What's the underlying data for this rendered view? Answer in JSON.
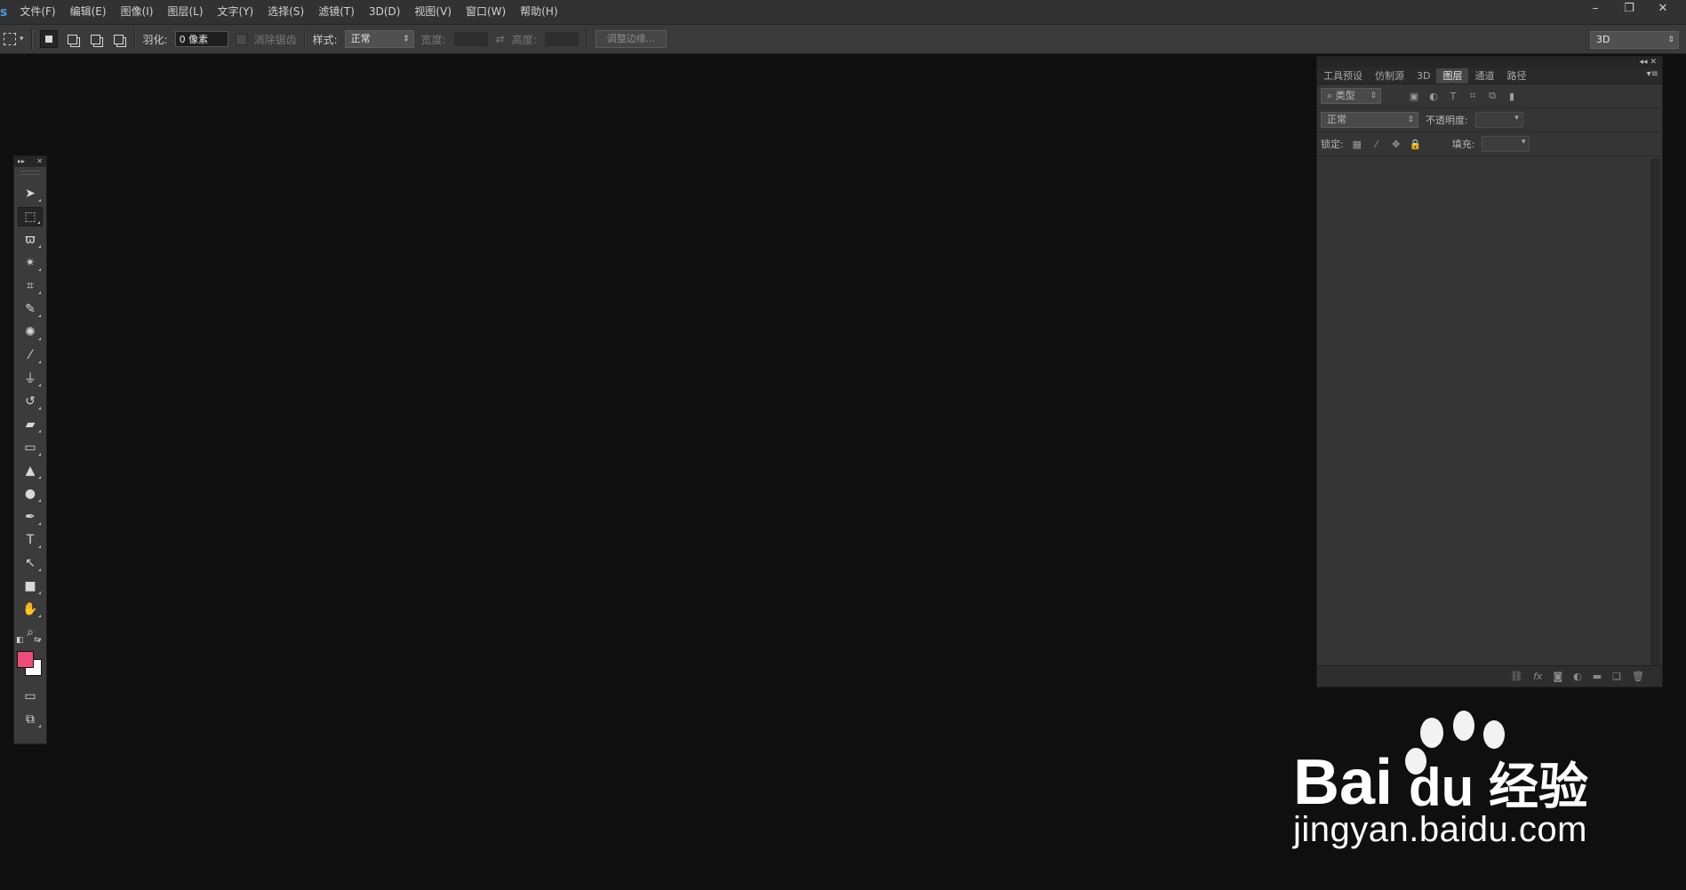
{
  "menubar": {
    "logo": "s",
    "items": [
      "文件(F)",
      "编辑(E)",
      "图像(I)",
      "图层(L)",
      "文字(Y)",
      "选择(S)",
      "滤镜(T)",
      "3D(D)",
      "视图(V)",
      "窗口(W)",
      "帮助(H)"
    ],
    "window_controls": [
      "–",
      "❐",
      "✕"
    ]
  },
  "options": {
    "feather_label": "羽化:",
    "feather_value": "0 像素",
    "antialias_label": "消除锯齿",
    "style_label": "样式:",
    "style_value": "正常",
    "width_label": "宽度:",
    "height_label": "高度:",
    "refine_label": "调整边缘...",
    "workspace_value": "3D"
  },
  "tools": {
    "items": [
      {
        "name": "move-tool",
        "glyph": "➤"
      },
      {
        "name": "rect-marquee-tool",
        "glyph": "⬚"
      },
      {
        "name": "lasso-tool",
        "glyph": "ϖ"
      },
      {
        "name": "magic-wand-tool",
        "glyph": "✴"
      },
      {
        "name": "crop-tool",
        "glyph": "⌗"
      },
      {
        "name": "eyedropper-tool",
        "glyph": "✎"
      },
      {
        "name": "healing-brush-tool",
        "glyph": "✺"
      },
      {
        "name": "brush-tool",
        "glyph": "⁄"
      },
      {
        "name": "clone-stamp-tool",
        "glyph": "⏚"
      },
      {
        "name": "history-brush-tool",
        "glyph": "↺"
      },
      {
        "name": "eraser-tool",
        "glyph": "▰"
      },
      {
        "name": "gradient-tool",
        "glyph": "▭"
      },
      {
        "name": "blur-tool",
        "glyph": "▲"
      },
      {
        "name": "dodge-tool",
        "glyph": "●"
      },
      {
        "name": "pen-tool",
        "glyph": "✒"
      },
      {
        "name": "type-tool",
        "glyph": "T"
      },
      {
        "name": "path-selection-tool",
        "glyph": "↖"
      },
      {
        "name": "rectangle-shape-tool",
        "glyph": "■"
      },
      {
        "name": "hand-tool",
        "glyph": "✋"
      },
      {
        "name": "zoom-tool",
        "glyph": "⌕"
      }
    ],
    "foreground_color": "#ee4a7a",
    "background_color": "#ffffff"
  },
  "layers_panel": {
    "tabs": [
      "工具预设",
      "仿制源",
      "3D",
      "图层",
      "通道",
      "路径"
    ],
    "active_tab": "图层",
    "filter_kind": "类型",
    "blend_mode": "正常",
    "opacity_label": "不透明度:",
    "lock_label": "锁定:",
    "fill_label": "填充:",
    "footer_icons": [
      "link-icon",
      "fx-icon",
      "mask-icon",
      "adjustment-icon",
      "folder-icon",
      "new-layer-icon",
      "trash-icon"
    ],
    "fx_text": "fx"
  },
  "watermark": {
    "brand_left": "Bai",
    "brand_right": "du",
    "brand_cn": "经验",
    "url": "jingyan.baidu.com"
  }
}
